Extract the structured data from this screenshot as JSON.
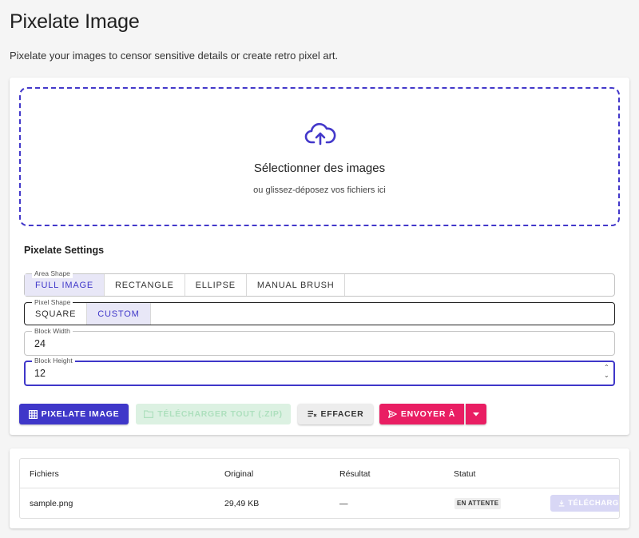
{
  "page": {
    "title": "Pixelate Image",
    "description": "Pixelate your images to censor sensitive details or create retro pixel art."
  },
  "dropzone": {
    "icon": "cloud-upload-icon",
    "title": "Sélectionner des images",
    "subtitle": "ou glissez-déposez vos fichiers ici",
    "border_color": "#4338ca"
  },
  "settings": {
    "title": "Pixelate Settings",
    "area_shape": {
      "label": "Area Shape",
      "options": [
        "FULL IMAGE",
        "RECTANGLE",
        "ELLIPSE",
        "MANUAL BRUSH"
      ],
      "selected": "FULL IMAGE"
    },
    "pixel_shape": {
      "label": "Pixel Shape",
      "options": [
        "SQUARE",
        "CUSTOM"
      ],
      "selected": "CUSTOM"
    },
    "block_width": {
      "label": "Block Width",
      "value": "24"
    },
    "block_height": {
      "label": "Block Height",
      "value": "12"
    }
  },
  "actions": {
    "pixelate": {
      "label": "PIXELATE IMAGE",
      "icon": "grid-icon"
    },
    "download_all": {
      "label": "TÉLÉCHARGER TOUT (.ZIP)",
      "icon": "folder-icon",
      "disabled": true
    },
    "clear": {
      "label": "EFFACER",
      "icon": "clear-list-icon"
    },
    "send_to": {
      "label": "ENVOYER À",
      "icon": "send-icon"
    },
    "send_menu": {
      "icon": "caret-down-icon"
    }
  },
  "files_table": {
    "headers": [
      "Fichiers",
      "Original",
      "Résultat",
      "Statut"
    ],
    "rows": [
      {
        "file": "sample.png",
        "original": "29,49 KB",
        "result": "—",
        "status": "EN ATTENTE",
        "action": "TÉLÉCHARGER"
      }
    ]
  },
  "colors": {
    "primary": "#3f37c9",
    "accent": "#e91e63",
    "success_disabled": "#dcf1e2"
  }
}
